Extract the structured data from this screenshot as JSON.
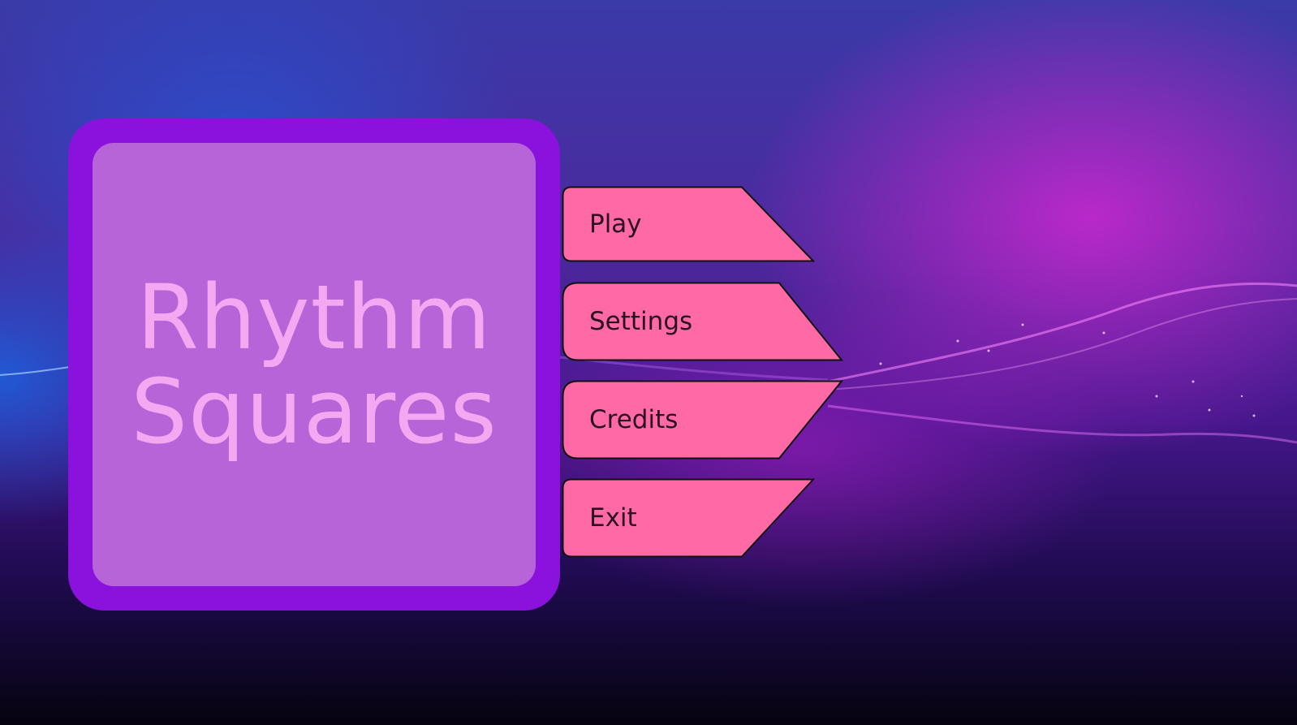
{
  "title": {
    "line1": "Rhythm",
    "line2": "Squares"
  },
  "menu": {
    "play_label": "Play",
    "settings_label": "Settings",
    "credits_label": "Credits",
    "exit_label": "Exit"
  },
  "colors": {
    "card_border": "#8a12dc",
    "card_fill": "#b664d8",
    "title_text": "#f5a8f2",
    "button_fill": "#ff6aa6",
    "button_outline": "#111111",
    "button_text": "#2b1020"
  }
}
